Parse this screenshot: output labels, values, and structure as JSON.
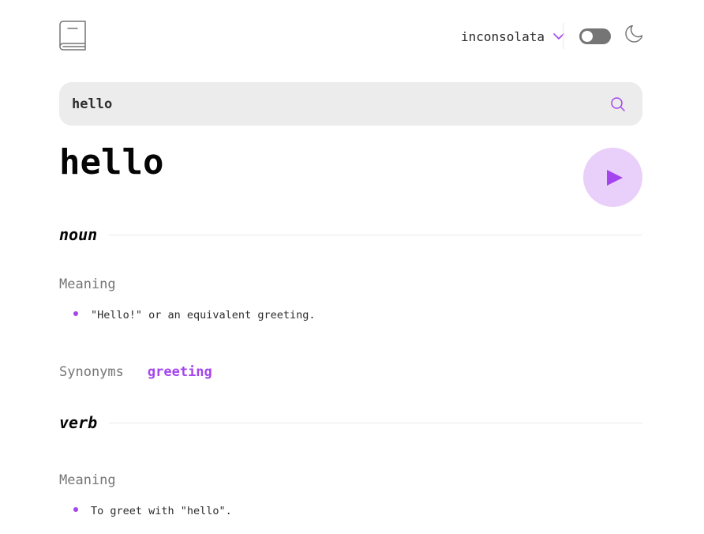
{
  "header": {
    "logo_icon": "book-icon",
    "font_selected": "inconsolata",
    "font_chevron_icon": "chevron-down-icon",
    "theme_toggle_state": "off",
    "theme_icon": "moon-icon"
  },
  "search": {
    "value": "hello",
    "icon": "search-icon"
  },
  "entry": {
    "word": "hello",
    "play_icon": "play-icon",
    "meanings": [
      {
        "part_of_speech": "noun",
        "meaning_heading": "Meaning",
        "definitions": [
          "\"Hello!\" or an equivalent greeting."
        ],
        "synonyms_label": "Synonyms",
        "synonyms": [
          "greeting"
        ]
      },
      {
        "part_of_speech": "verb",
        "meaning_heading": "Meaning",
        "definitions": [
          "To greet with \"hello\"."
        ]
      }
    ]
  },
  "colors": {
    "accent": "#a445ed",
    "accent_light": "#e9d0fa",
    "search_bg": "#ececec",
    "muted_text": "#757575",
    "divider": "#e9e9e9"
  }
}
